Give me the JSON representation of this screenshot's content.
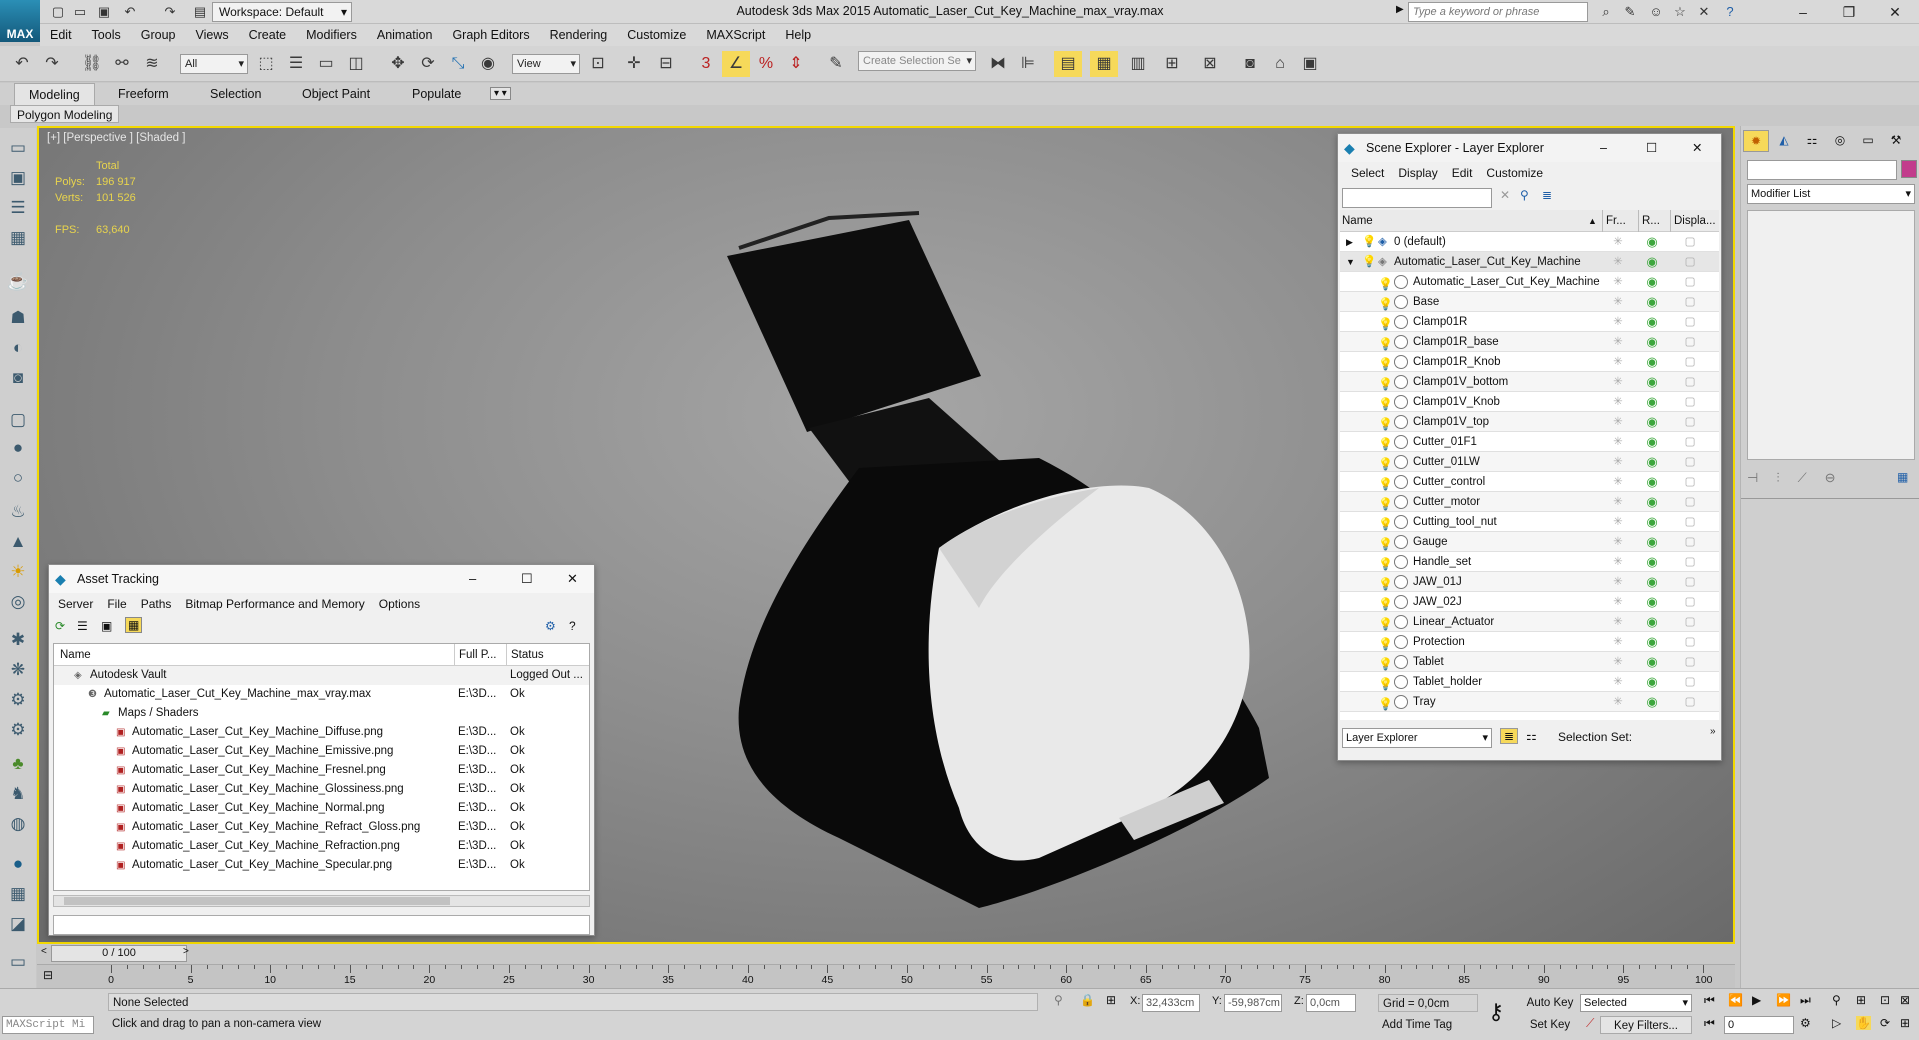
{
  "app": {
    "logo_text": "MAX",
    "workspace": "Workspace: Default",
    "title": "Autodesk 3ds Max  2015      Automatic_Laser_Cut_Key_Machine_max_vray.max",
    "search_placeholder": "Type a keyword or phrase"
  },
  "menu": [
    "Edit",
    "Tools",
    "Group",
    "Views",
    "Create",
    "Modifiers",
    "Animation",
    "Graph Editors",
    "Rendering",
    "Customize",
    "MAXScript",
    "Help"
  ],
  "toolbar": {
    "selection_filter": "All",
    "ref_coord": "View",
    "snap_label": "3",
    "selection_set_placeholder": "Create Selection Se"
  },
  "ribbon": {
    "tabs": [
      "Modeling",
      "Freeform",
      "Selection",
      "Object Paint",
      "Populate"
    ],
    "active_tab": "Modeling",
    "sub_label": "Polygon Modeling"
  },
  "viewport": {
    "label": "[+] [Perspective ] [Shaded ]",
    "stats": {
      "total_label": "Total",
      "polys_label": "Polys:",
      "polys": "196 917",
      "verts_label": "Verts:",
      "verts": "101 526",
      "fps_label": "FPS:",
      "fps": "63,640"
    }
  },
  "asset_tracking": {
    "title": "Asset Tracking",
    "menu": [
      "Server",
      "File",
      "Paths",
      "Bitmap Performance and Memory",
      "Options"
    ],
    "columns": [
      "Name",
      "Full P...",
      "Status"
    ],
    "rows": [
      {
        "name": "Autodesk Vault",
        "path": "",
        "status": "Logged Out ...",
        "indent": 0
      },
      {
        "name": "Automatic_Laser_Cut_Key_Machine_max_vray.max",
        "path": "E:\\3D...",
        "status": "Ok",
        "indent": 1
      },
      {
        "name": "Maps / Shaders",
        "path": "",
        "status": "",
        "indent": 2
      },
      {
        "name": "Automatic_Laser_Cut_Key_Machine_Diffuse.png",
        "path": "E:\\3D...",
        "status": "Ok",
        "indent": 3
      },
      {
        "name": "Automatic_Laser_Cut_Key_Machine_Emissive.png",
        "path": "E:\\3D...",
        "status": "Ok",
        "indent": 3
      },
      {
        "name": "Automatic_Laser_Cut_Key_Machine_Fresnel.png",
        "path": "E:\\3D...",
        "status": "Ok",
        "indent": 3
      },
      {
        "name": "Automatic_Laser_Cut_Key_Machine_Glossiness.png",
        "path": "E:\\3D...",
        "status": "Ok",
        "indent": 3
      },
      {
        "name": "Automatic_Laser_Cut_Key_Machine_Normal.png",
        "path": "E:\\3D...",
        "status": "Ok",
        "indent": 3
      },
      {
        "name": "Automatic_Laser_Cut_Key_Machine_Refract_Gloss.png",
        "path": "E:\\3D...",
        "status": "Ok",
        "indent": 3
      },
      {
        "name": "Automatic_Laser_Cut_Key_Machine_Refraction.png",
        "path": "E:\\3D...",
        "status": "Ok",
        "indent": 3
      },
      {
        "name": "Automatic_Laser_Cut_Key_Machine_Specular.png",
        "path": "E:\\3D...",
        "status": "Ok",
        "indent": 3
      }
    ]
  },
  "scene_explorer": {
    "title": "Scene Explorer - Layer Explorer",
    "menu": [
      "Select",
      "Display",
      "Edit",
      "Customize"
    ],
    "columns": [
      "Name",
      "Fr...",
      "R...",
      "Displa..."
    ],
    "layers": [
      "0 (default)",
      "Automatic_Laser_Cut_Key_Machine"
    ],
    "objects": [
      "Automatic_Laser_Cut_Key_Machine",
      "Base",
      "Clamp01R",
      "Clamp01R_base",
      "Clamp01R_Knob",
      "Clamp01V_bottom",
      "Clamp01V_Knob",
      "Clamp01V_top",
      "Cutter_01F1",
      "Cutter_01LW",
      "Cutter_control",
      "Cutter_motor",
      "Cutting_tool_nut",
      "Gauge",
      "Handle_set",
      "JAW_01J",
      "JAW_02J",
      "Linear_Actuator",
      "Protection",
      "Tablet",
      "Tablet_holder",
      "Tray"
    ],
    "footer_dropdown": "Layer Explorer",
    "selection_set_label": "Selection Set:"
  },
  "command_panel": {
    "modifier_list": "Modifier List"
  },
  "timeline": {
    "frame": "0 / 100",
    "ticks": [
      "0",
      "5",
      "10",
      "15",
      "20",
      "25",
      "30",
      "35",
      "40",
      "45",
      "50",
      "55",
      "60",
      "65",
      "70",
      "75",
      "80",
      "85",
      "90",
      "95",
      "100"
    ]
  },
  "status": {
    "maxscript": "MAXScript Mi",
    "selection": "None Selected",
    "prompt": "Click and drag to pan a non-camera view",
    "x_label": "X:",
    "x": "32,433cm",
    "y_label": "Y:",
    "y": "-59,987cm",
    "z_label": "Z:",
    "z": "0,0cm",
    "grid": "Grid = 0,0cm",
    "add_time_tag": "Add Time Tag",
    "auto_key": "Auto Key",
    "set_key": "Set Key",
    "key_mode": "Selected",
    "key_filters": "Key Filters...",
    "current_frame": "0"
  }
}
